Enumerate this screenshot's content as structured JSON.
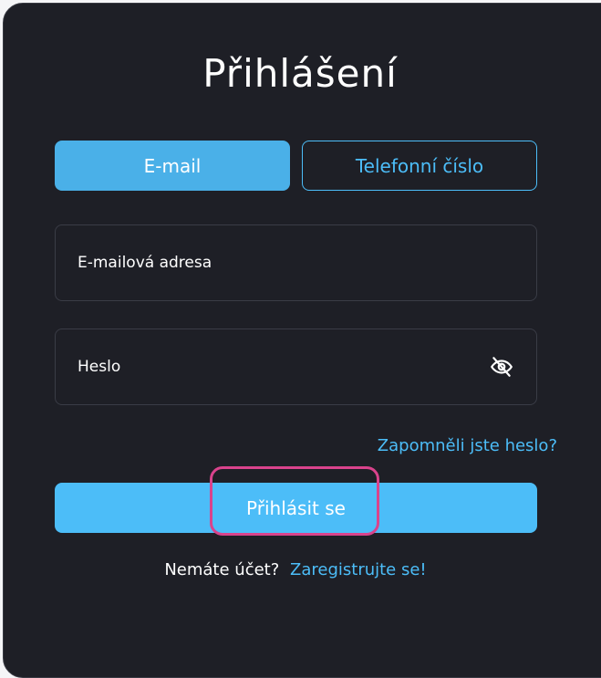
{
  "login": {
    "title": "Přihlášení",
    "tabs": {
      "email": "E-mail",
      "phone": "Telefonní číslo"
    },
    "fields": {
      "email_placeholder": "E-mailová adresa",
      "password_placeholder": "Heslo",
      "password_toggle_icon": "eye-slash-icon"
    },
    "forgot_password": "Zapomněli jste heslo?",
    "submit": "Přihlásit se",
    "register": {
      "prompt": "Nemáte účet?",
      "link": "Zaregistrujte se!"
    }
  },
  "colors": {
    "background": "#1e1f26",
    "accent": "#4cbdf8",
    "active_tab": "#4ab0e8",
    "highlight": "#d9438c"
  }
}
